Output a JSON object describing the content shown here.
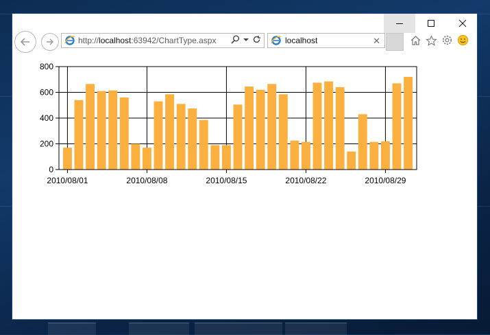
{
  "browser": {
    "address_prefix": "http://",
    "address_host": "localhost",
    "address_rest": ":63942/ChartType.aspx",
    "tab_title": "localhost",
    "icons": [
      "back-arrow-icon",
      "forward-arrow-icon",
      "ie-logo-icon",
      "search-icon",
      "dropdown-arrow-icon",
      "refresh-icon",
      "close-tab-icon",
      "home-icon",
      "favorites-star-icon",
      "settings-gear-icon",
      "smiley-feedback-icon",
      "minimize-icon",
      "maximize-icon",
      "close-icon"
    ]
  },
  "chart_data": {
    "type": "bar",
    "x": [
      "2010/08/01",
      "2010/08/02",
      "2010/08/03",
      "2010/08/04",
      "2010/08/05",
      "2010/08/06",
      "2010/08/07",
      "2010/08/08",
      "2010/08/09",
      "2010/08/10",
      "2010/08/11",
      "2010/08/12",
      "2010/08/13",
      "2010/08/14",
      "2010/08/15",
      "2010/08/16",
      "2010/08/17",
      "2010/08/18",
      "2010/08/19",
      "2010/08/20",
      "2010/08/21",
      "2010/08/22",
      "2010/08/23",
      "2010/08/24",
      "2010/08/25",
      "2010/08/26",
      "2010/08/27",
      "2010/08/28",
      "2010/08/29",
      "2010/08/30",
      "2010/08/31"
    ],
    "values": [
      170,
      540,
      665,
      610,
      615,
      560,
      200,
      170,
      530,
      585,
      510,
      475,
      385,
      190,
      190,
      505,
      645,
      620,
      665,
      585,
      225,
      215,
      675,
      685,
      640,
      140,
      430,
      215,
      220,
      670,
      720
    ],
    "x_tick_labels": [
      "2010/08/01",
      "2010/08/08",
      "2010/08/15",
      "2010/08/22",
      "2010/08/29"
    ],
    "y_ticks": [
      0,
      200,
      400,
      600,
      800
    ],
    "ylim": [
      0,
      800
    ],
    "grid": true,
    "bar_color": "#FBB040"
  }
}
